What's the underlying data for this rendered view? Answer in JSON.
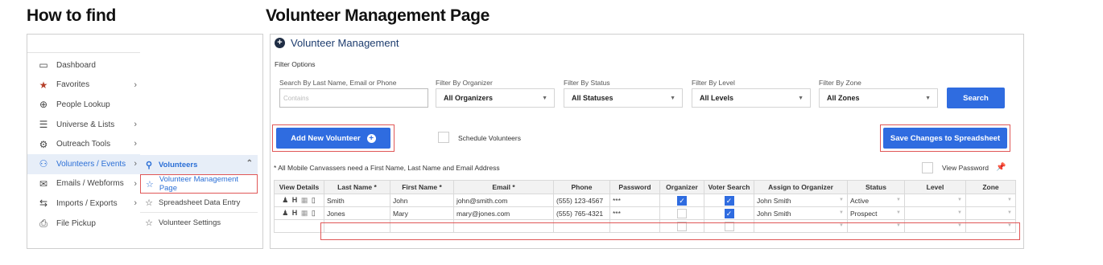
{
  "headings": {
    "how_to_find": "How to find",
    "page": "Volunteer Management Page"
  },
  "menu": [
    {
      "label": "Dashboard",
      "icon": "monitor-icon",
      "glyph": "▭",
      "chevron": false
    },
    {
      "label": "Favorites",
      "icon": "star-icon",
      "glyph": "★",
      "chevron": true
    },
    {
      "label": "People Lookup",
      "icon": "search-person-icon",
      "glyph": "⊕",
      "chevron": false
    },
    {
      "label": "Universe & Lists",
      "icon": "list-icon",
      "glyph": "☰",
      "chevron": true
    },
    {
      "label": "Outreach Tools",
      "icon": "tools-icon",
      "glyph": "⚙",
      "chevron": true
    },
    {
      "label": "Volunteers / Events",
      "icon": "people-icon",
      "glyph": "⚇",
      "chevron": true
    },
    {
      "label": "Emails / Webforms",
      "icon": "email-icon",
      "glyph": "✉",
      "chevron": true
    },
    {
      "label": "Imports / Exports",
      "icon": "import-export-icon",
      "glyph": "⇆",
      "chevron": true
    },
    {
      "label": "File Pickup",
      "icon": "file-pickup-icon",
      "glyph": "⎙",
      "chevron": false
    }
  ],
  "submenu": {
    "header": "Volunteers",
    "items": [
      "Volunteer Management Page",
      "Spreadsheet Data Entry",
      "Volunteer Settings"
    ]
  },
  "panel": {
    "title": "Volunteer Management",
    "filter_options": "Filter Options",
    "search_label": "Search By Last Name, Email or Phone",
    "search_placeholder": "Contains",
    "filters": [
      {
        "label": "Filter By Organizer",
        "value": "All Organizers"
      },
      {
        "label": "Filter By Status",
        "value": "All Statuses"
      },
      {
        "label": "Filter By Level",
        "value": "All Levels"
      },
      {
        "label": "Filter By Zone",
        "value": "All Zones"
      }
    ],
    "search_button": "Search",
    "add_button": "Add New Volunteer",
    "schedule_label": "Schedule Volunteers",
    "save_button": "Save Changes to Spreadsheet",
    "note": "* All Mobile Canvassers need a First Name, Last Name and Email Address",
    "view_password": "View Password"
  },
  "table": {
    "columns": [
      "View Details",
      "Last Name *",
      "First Name *",
      "Email *",
      "Phone",
      "Password",
      "Organizer",
      "Voter Search",
      "Assign to Organizer",
      "Status",
      "Level",
      "Zone"
    ],
    "rows": [
      {
        "last": "Smith",
        "first": "John",
        "email": "john@smith.com",
        "phone": "(555) 123-4567",
        "password": "***",
        "organizer": true,
        "voter_search": true,
        "assign": "John Smith",
        "status": "Active",
        "level": "",
        "zone": ""
      },
      {
        "last": "Jones",
        "first": "Mary",
        "email": "mary@jones.com",
        "phone": "(555) 765-4321",
        "password": "***",
        "organizer": false,
        "voter_search": true,
        "assign": "John Smith",
        "status": "Prospect",
        "level": "",
        "zone": ""
      },
      {
        "last": "",
        "first": "",
        "email": "",
        "phone": "",
        "password": "",
        "organizer": false,
        "voter_search": false,
        "assign": "",
        "status": "",
        "level": "",
        "zone": ""
      }
    ]
  },
  "colors": {
    "accent": "#2f6ce0",
    "highlight_border": "#e05757",
    "active_bg": "#e7eef8"
  }
}
